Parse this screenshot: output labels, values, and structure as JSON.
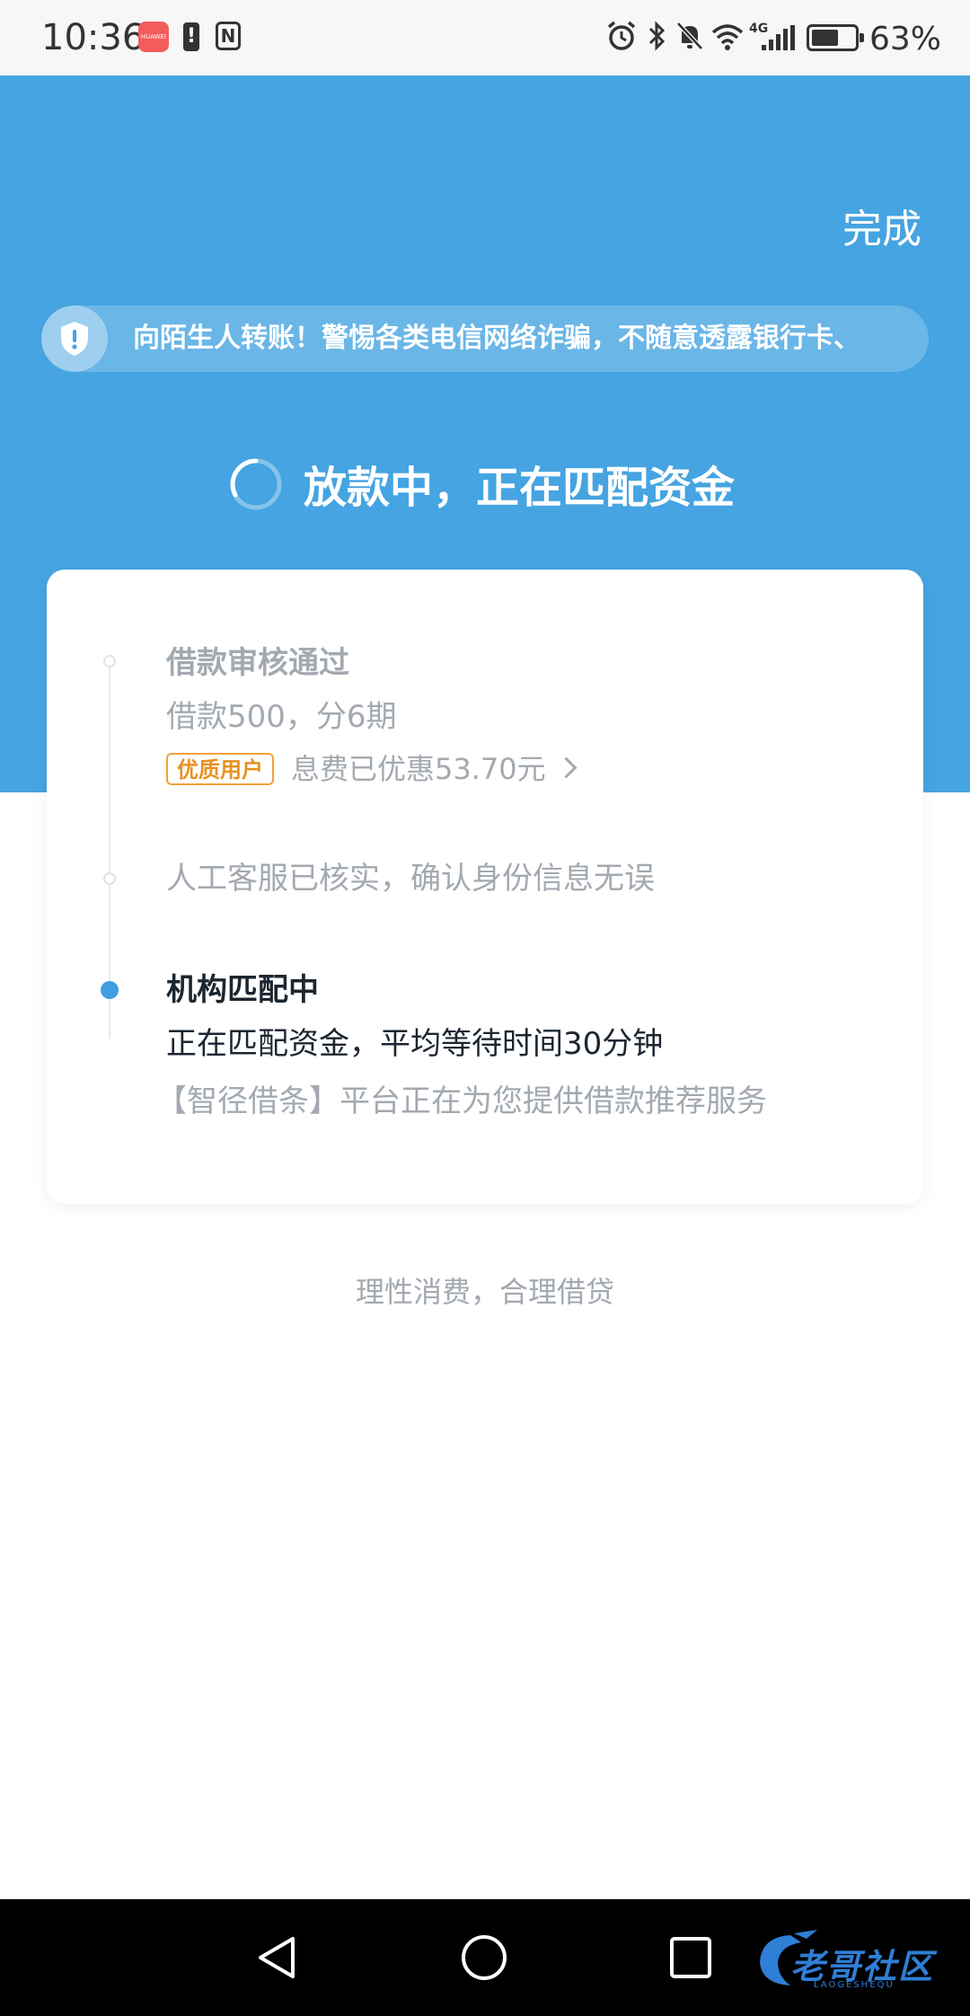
{
  "status_bar": {
    "time": "10:36",
    "app_icon_text": "HUAWEI",
    "alert_icon": "!",
    "nfc_icon": "N",
    "signal_label": "4G",
    "battery_percent": "63%",
    "battery_level": 0.63
  },
  "header": {
    "done_label": "完成",
    "notice_text": "向陌生人转账！警惕各类电信网络诈骗，不随意透露银行卡、",
    "progress_title": "放款中，正在匹配资金",
    "background_color": "#45a4e1"
  },
  "timeline": {
    "step1": {
      "title": "借款审核通过",
      "detail": "借款500，分6期",
      "tag": "优质用户",
      "discount": "息费已优惠53.70元"
    },
    "step2": {
      "title": "人工客服已核实，确认身份信息无误"
    },
    "step3": {
      "title": "机构匹配中",
      "detail": "正在匹配资金，平均等待时间30分钟",
      "note": "【智径借条】平台正在为您提供借款推荐服务"
    }
  },
  "footer": {
    "slogan": "理性消费，合理借贷"
  },
  "watermark": {
    "text": "老哥社区",
    "sub": "LAOGESHEQU"
  },
  "icons": {
    "shield": "shield-alert-icon",
    "spinner": "loading-spinner-icon",
    "chevron": "chevron-right-icon",
    "nav_back": "triangle-back-icon",
    "nav_home": "circle-home-icon",
    "nav_recents": "square-recents-icon"
  }
}
